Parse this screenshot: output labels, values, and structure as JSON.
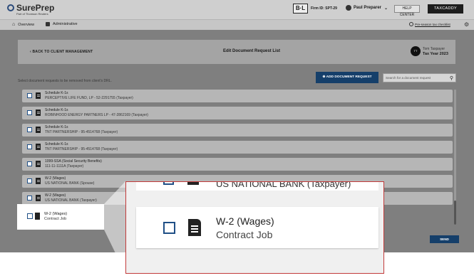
{
  "brand": {
    "name": "SurePrep",
    "sub": "Part of Thomson Reuters"
  },
  "header": {
    "badge": "B·L",
    "firm_id": "Firm ID: SPT-29",
    "user": "Paul Preparer",
    "help": "HELP CENTER",
    "app_switch": "TAXCADDY"
  },
  "nav": {
    "overview": "Overview",
    "administrative": "Administrative",
    "checklist": "Pre-season tax checklist"
  },
  "page": {
    "back": "BACK TO CLIENT MANAGEMENT",
    "title": "Edit Document Request List",
    "client_initials": "TT",
    "client_name": "Tom Taxpayer",
    "tax_year": "Tax Year 2023",
    "instruction": "Select document requests to be removed from client's DRL.",
    "add_button": "ADD DOCUMENT REQUEST",
    "search_placeholder": "Search for a document request",
    "send_button": "SEND"
  },
  "rows": [
    {
      "title": "Schedule K-1s",
      "sub": "PERCEPTIVE LIFE FUND, LP - 52-2291755 (Taxpayer)"
    },
    {
      "title": "Schedule K-1s",
      "sub": "ROBINHOOD ENERGY PARTNERS LP - 47-2862169 (Taxpayer)"
    },
    {
      "title": "Schedule K-1s",
      "sub": "TNT PARTNERSHIP - 95-4514768 (Taxpayer)"
    },
    {
      "title": "Schedule K-1s",
      "sub": "TNT PARTNERSHIP - 95-4514768 (Taxpayer)"
    },
    {
      "title": "1099-SSA (Social Security Benefits)",
      "sub": "111-11-1111A (Taxpayer)"
    },
    {
      "title": "W-2 (Wages)",
      "sub": "US NATIONAL BANK (Spouse)"
    },
    {
      "title": "W-2 (Wages)",
      "sub": "US NATIONAL BANK (Taxpayer)"
    }
  ],
  "highlight": {
    "title": "W-2 (Wages)",
    "sub": "Contract Job"
  },
  "zoom": {
    "prev_sub": "US NATIONAL BANK (Taxpayer)",
    "title": "W-2 (Wages)",
    "sub": "Contract Job"
  }
}
